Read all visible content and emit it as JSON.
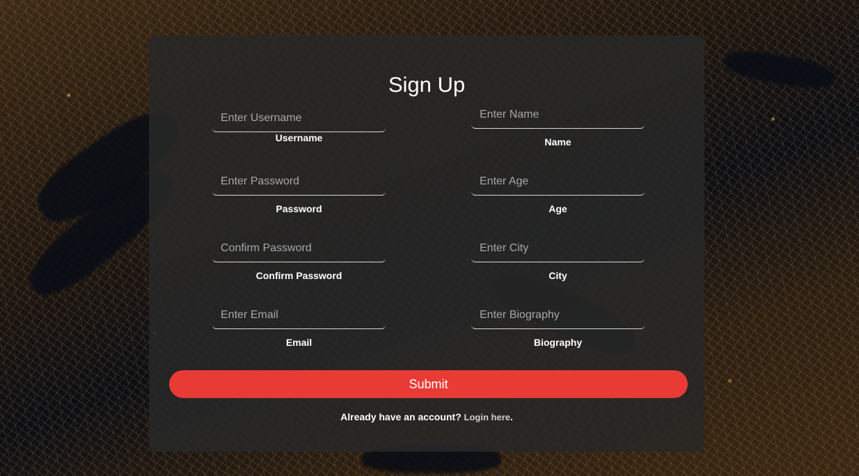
{
  "form": {
    "title": "Sign Up",
    "fields": [
      {
        "placeholder": "Enter Username",
        "value": "",
        "label": "Username"
      },
      {
        "placeholder": "Enter Name",
        "value": "",
        "label": "Name"
      },
      {
        "placeholder": "Enter Password",
        "value": "",
        "label": "Password"
      },
      {
        "placeholder": "Enter Age",
        "value": "",
        "label": "Age"
      },
      {
        "placeholder": "Confirm Password",
        "value": "",
        "label": "Confirm Password"
      },
      {
        "placeholder": "Enter City",
        "value": "",
        "label": "City"
      },
      {
        "placeholder": "Enter Email",
        "value": "",
        "label": "Email"
      },
      {
        "placeholder": "Enter Biography",
        "value": "",
        "label": "Biography"
      }
    ],
    "submit_label": "Submit",
    "footer_text": "Already have an account?",
    "login_link": "Login here",
    "footer_period": "."
  },
  "colors": {
    "submit": "#e83b36",
    "panel": "#282828"
  }
}
